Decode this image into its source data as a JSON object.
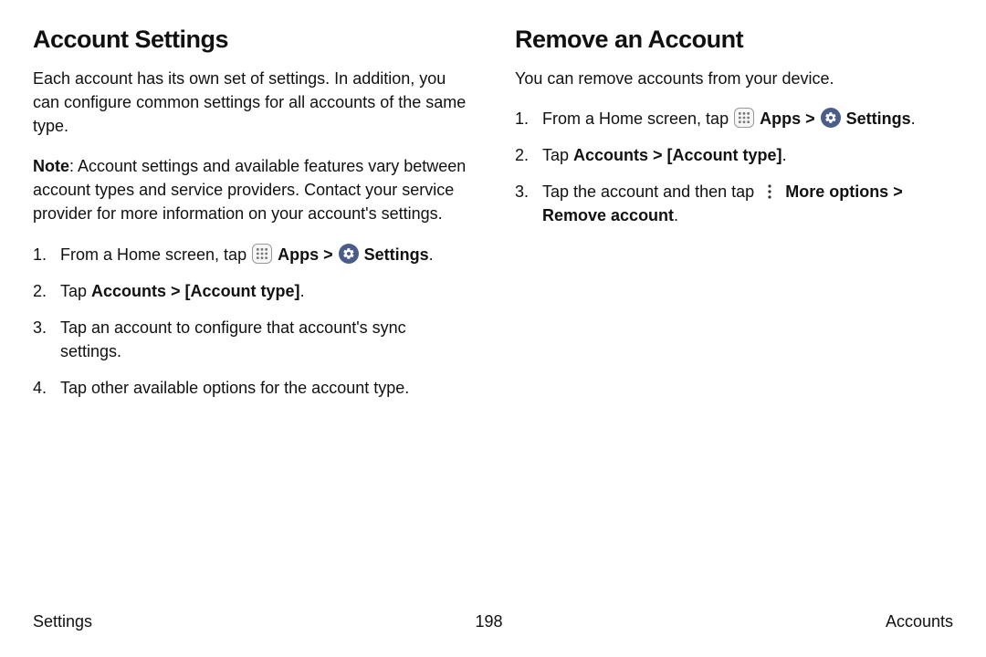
{
  "left": {
    "heading": "Account Settings",
    "intro": "Each account has its own set of settings. In addition, you can configure common settings for all accounts of the same type.",
    "note_label": "Note",
    "note_body": ": Account settings and available features vary between account types and service providers. Contact your service provider for more information on your account's settings.",
    "steps": {
      "s1_pre": "From a Home screen, tap ",
      "s1_apps": "Apps",
      "s1_sep": " > ",
      "s1_settings": "Settings",
      "s1_end": ".",
      "s2_pre": "Tap ",
      "s2_bold": "Accounts > [Account type]",
      "s2_end": ".",
      "s3": "Tap an account to configure that account's sync settings.",
      "s4": "Tap other available options for the account type."
    }
  },
  "right": {
    "heading": "Remove an Account",
    "intro": "You can remove accounts from your device.",
    "steps": {
      "s1_pre": "From a Home screen, tap ",
      "s1_apps": "Apps",
      "s1_sep": " > ",
      "s1_settings": "Settings",
      "s1_end": ".",
      "s2_pre": "Tap ",
      "s2_bold": "Accounts > [Account type]",
      "s2_end": ".",
      "s3_pre": "Tap the account and then tap ",
      "s3_more": "More options",
      "s3_sep": " > ",
      "s3_remove": "Remove account",
      "s3_end": "."
    }
  },
  "footer": {
    "left": "Settings",
    "center": "198",
    "right": "Accounts"
  }
}
